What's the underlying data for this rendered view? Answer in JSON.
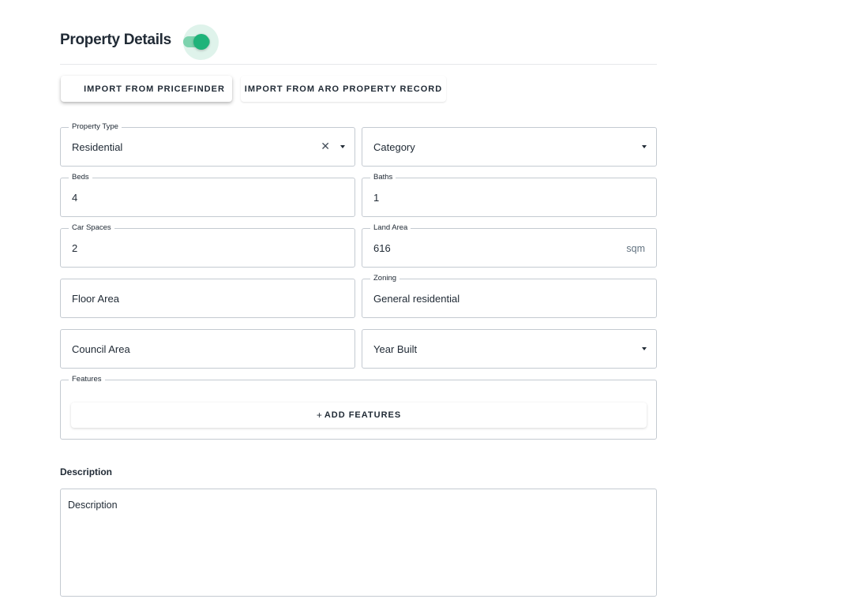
{
  "section": {
    "title": "Property Details",
    "toggle_on": true,
    "accent_color": "#1fb37a"
  },
  "actions": {
    "import_pricefinder": "IMPORT FROM PRICEFINDER",
    "import_aro": "IMPORT FROM ARO PROPERTY RECORD"
  },
  "fields": {
    "property_type": {
      "label": "Property Type",
      "value": "Residential"
    },
    "category": {
      "placeholder": "Category"
    },
    "beds": {
      "label": "Beds",
      "value": "4"
    },
    "baths": {
      "label": "Baths",
      "value": "1"
    },
    "car_spaces": {
      "label": "Car Spaces",
      "value": "2"
    },
    "land_area": {
      "label": "Land Area",
      "value": "616",
      "unit": "sqm"
    },
    "floor_area": {
      "placeholder": "Floor Area"
    },
    "zoning": {
      "label": "Zoning",
      "value": "General residential"
    },
    "council_area": {
      "placeholder": "Council Area"
    },
    "year_built": {
      "placeholder": "Year Built"
    }
  },
  "features": {
    "label": "Features",
    "add_label": "ADD FEATURES",
    "add_icon": "+"
  },
  "description": {
    "heading": "Description",
    "placeholder": "Description"
  }
}
